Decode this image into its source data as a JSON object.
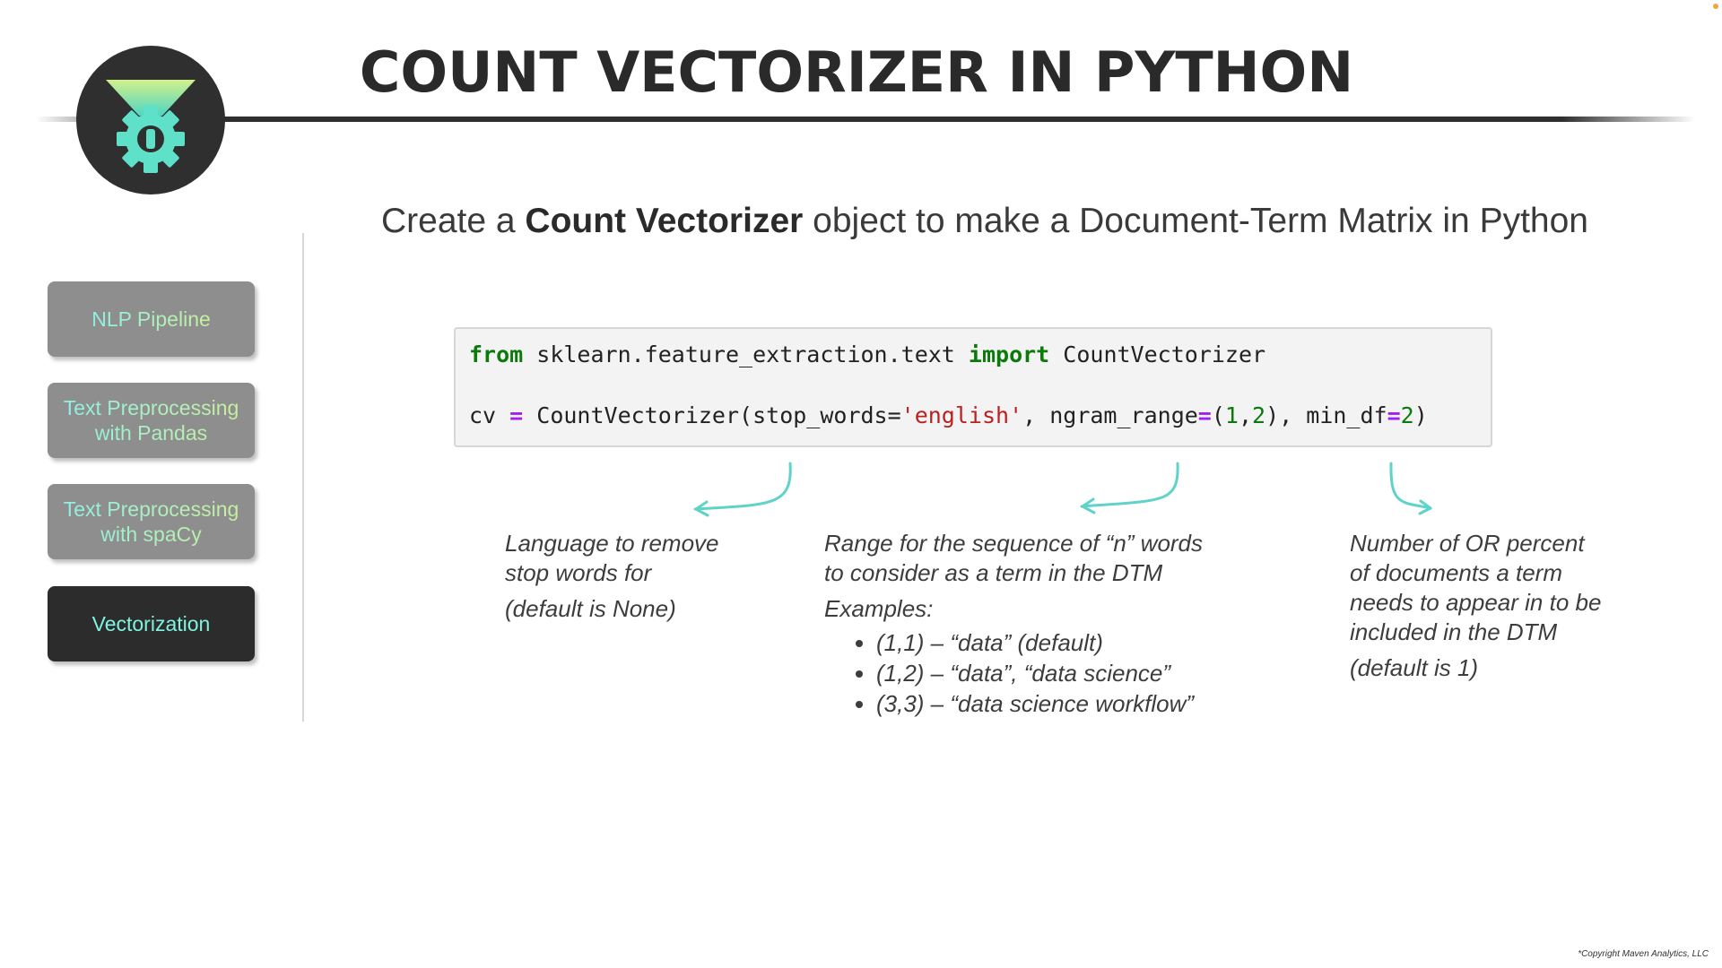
{
  "header": {
    "title": "COUNT VECTORIZER IN PYTHON"
  },
  "logo": {
    "icon": "funnel-gear-icon"
  },
  "sidebar": {
    "items": [
      {
        "label": "NLP Pipeline",
        "active": false
      },
      {
        "label": "Text Preprocessing with Pandas",
        "line1": "Text Preprocessing",
        "line2": "with Pandas",
        "active": false
      },
      {
        "label": "Text Preprocessing with spaCy",
        "line1": "Text Preprocessing",
        "line2": "with spaCy",
        "active": false
      },
      {
        "label": "Vectorization",
        "active": true
      }
    ]
  },
  "subtitle": {
    "before": "Create a ",
    "bold": "Count Vectorizer",
    "after": " object to make a Document-Term Matrix in Python"
  },
  "code": {
    "line1": {
      "kw_from": "from",
      "module": " sklearn.feature_extraction.text ",
      "kw_import": "import",
      "name": " CountVectorizer"
    },
    "line2": {
      "var": "cv ",
      "eq": "=",
      "call": " CountVectorizer(stop_words=",
      "str": "'english'",
      "arg2": ", ngram_range",
      "eq2": "=",
      "p_open": "(",
      "n1": "1",
      "comma": ",",
      "n2": "2",
      "p_close": "), min_df",
      "eq3": "=",
      "n3": "2",
      "end": ")"
    }
  },
  "annotations": {
    "stop_words": {
      "line1": "Language to remove",
      "line2": "stop words for",
      "default": "(default is None)"
    },
    "ngram_range": {
      "line1": "Range for the sequence of “n” words",
      "line2": "to consider as a term in the DTM",
      "examples_label": "Examples:",
      "examples": [
        "(1,1) – “data” (default)",
        "(1,2) – “data”, “data science”",
        "(3,3) – “data science workflow”"
      ]
    },
    "min_df": {
      "line1": "Number of OR percent",
      "line2": "of documents a term",
      "line3": "needs to appear in to be",
      "line4": "included in the DTM",
      "default": "(default is 1)"
    }
  },
  "colors": {
    "accent": "#5fd3c8",
    "dark": "#2f2f2f",
    "nav_inactive": "#8e8e8e",
    "keyword": "#0b7a0b",
    "operator": "#a020f0",
    "string": "#ba2121"
  },
  "footer": {
    "copyright": "*Copyright Maven Analytics, LLC"
  }
}
